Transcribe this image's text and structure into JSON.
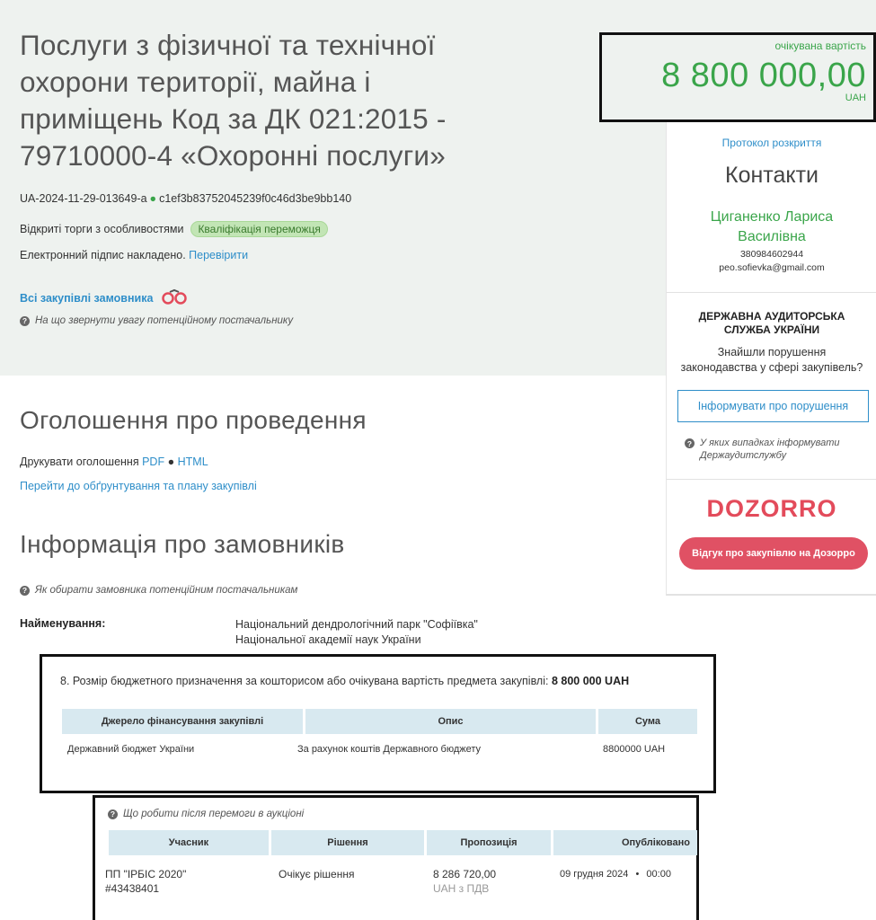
{
  "tender": {
    "title": "Послуги з фізичної та технічної охорони території, майна і приміщень Код за ДК 021:2015 - 79710000-4 «Охоронні послуги»",
    "id": "UA-2024-11-29-013649-a",
    "hash": "c1ef3b83752045239f0c46d3be9bb140",
    "procedure": "Відкриті торги з особливостями",
    "status_badge": "Кваліфікація переможця",
    "signature_text": "Електронний підпис накладено.",
    "signature_link": "Перевірити",
    "all_purchases_link": "Всі закупівлі замовника",
    "supplier_hint": "На що звернути увагу потенційному постачальнику"
  },
  "cost": {
    "label": "очікувана вартість",
    "value": "8 800 000,00",
    "currency": "UAH"
  },
  "sidebar": {
    "protocol_link": "Протокол розкриття",
    "contacts_title": "Контакти",
    "contact_name_line1": "Циганенко Лариса",
    "contact_name_line2": "Василівна",
    "phone": "380984602944",
    "email": "peo.sofievka@gmail.com",
    "audit_title_line1": "ДЕРЖАВНА АУДИТОРСЬКА",
    "audit_title_line2": "СЛУЖБА УКРАЇНИ",
    "audit_text_line1": "Знайшли порушення",
    "audit_text_line2": "законодавства у сфері закупівель?",
    "report_button": "Інформувати про порушення",
    "audit_hint": "У яких випадках інформувати Держаудитслужбу",
    "dozorro_logo": "DOZORRO",
    "dozorro_button": "Відгук про закупівлю на Дозорро"
  },
  "announcement": {
    "heading": "Оголошення про проведення",
    "print_label": "Друкувати оголошення",
    "pdf_link": "PDF",
    "html_link": "HTML",
    "plan_link": "Перейти до обґрунтування та плану закупівлі"
  },
  "customers": {
    "heading": "Інформація про замовників",
    "hint": "Як обирати замовника потенційним постачальникам",
    "name_label": "Найменування:",
    "name_line1": "Національний дендрологічний парк \"Софіївка\"",
    "name_line2": "Національної академії наук України"
  },
  "budget": {
    "title_prefix": "8. Розмір бюджетного призначення за кошторисом або очікувана вартість предмета закупівлі:",
    "title_amount": "8 800 000 UAH",
    "headers": [
      "Джерело фінансування закупівлі",
      "Опис",
      "Сума"
    ],
    "row": [
      "Державний бюджет України",
      "За рахунок коштів Державного бюджету",
      "8800000 UAH"
    ]
  },
  "auction": {
    "hint": "Що робити після перемоги в аукціоні",
    "headers": [
      "Учасник",
      "Рішення",
      "Пропозиція",
      "Опубліковано"
    ],
    "participant_line1": "ПП \"ІРБІС 2020\"",
    "participant_line2": "#43438401",
    "decision": "Очікує рішення",
    "offer_value": "8 286 720,00",
    "offer_note": "UAH з ПДВ",
    "published_date": "09 грудня 2024",
    "published_time": "00:00"
  },
  "colors": {
    "accent_green": "#3aa54a",
    "link_blue": "#2e8ec9",
    "dozorro_red": "#e34b5b",
    "table_header": "#d8e9f0",
    "top_band": "#eef2ef"
  }
}
